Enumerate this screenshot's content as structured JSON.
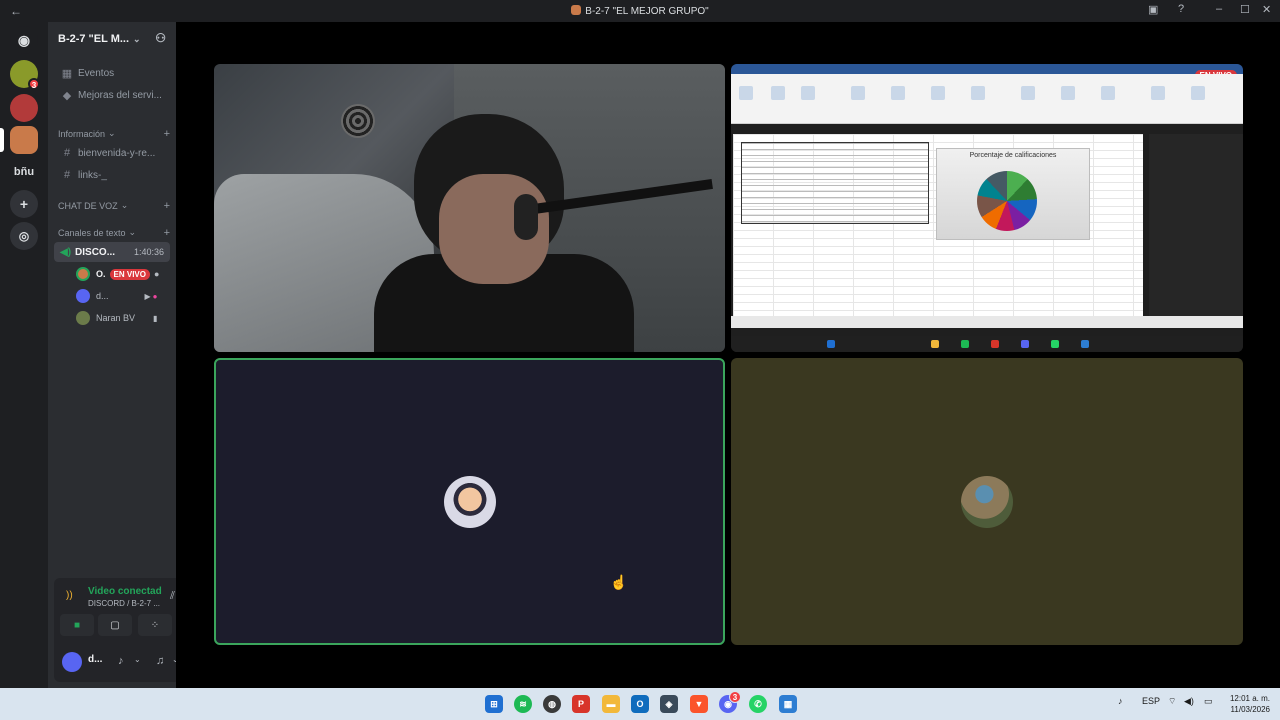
{
  "window": {
    "title": "B-2-7 \"EL MEJOR GRUPO\""
  },
  "rail": {
    "dm_icon": "discord-logo-icon",
    "servers": [
      {
        "name": "server-1",
        "color": "#8a9a2a",
        "badge": "3"
      },
      {
        "name": "server-2",
        "color": "#b23a3a"
      },
      {
        "name": "server-3",
        "color": "#c97a4a",
        "active": true
      },
      {
        "name": "server-4",
        "label": "bñu",
        "color": "#1e1f22"
      }
    ],
    "add_server_icon": "plus-icon",
    "discover_icon": "compass-icon"
  },
  "server": {
    "name": "B-2-7 \"EL M...",
    "top_items": [
      {
        "label": "Eventos",
        "icon": "calendar-icon"
      },
      {
        "label": "Mejoras del servi...",
        "icon": "boost-icon"
      }
    ],
    "categories": {
      "info": "Información",
      "voice": "CHAT DE VOZ",
      "text": "Canales de texto"
    },
    "text_channels": [
      {
        "label": "bienvenida-y-re..."
      },
      {
        "label": "links-_"
      }
    ],
    "voice_channel": {
      "label": "DISCO...",
      "timer": "1:40:36"
    },
    "voice_users": [
      {
        "name": "O.",
        "live": "EN VIVO",
        "color": "#c97a4a"
      },
      {
        "name": "d...",
        "color": "#5865f2"
      },
      {
        "name": "Naran BV",
        "color": "#6b7b4a"
      }
    ]
  },
  "voice_panel": {
    "status": "Video conectad",
    "channel": "DISCORD / B-2-7 ..."
  },
  "user": {
    "name": "d..."
  },
  "stage": {
    "live_badge": "EN VIVO",
    "spreadsheet": {
      "chart_title": "Porcentaje de calificaciones"
    }
  },
  "taskbar": {
    "apps": [
      {
        "name": "windows-start",
        "color": "#1f6fd1"
      },
      {
        "name": "spotify",
        "color": "#1db954"
      },
      {
        "name": "obs",
        "color": "#3a3a3a"
      },
      {
        "name": "pdf",
        "color": "#d8352a"
      },
      {
        "name": "files",
        "color": "#f2b83a"
      },
      {
        "name": "outlook",
        "color": "#0f6cbd"
      },
      {
        "name": "davinci",
        "color": "#3a4a5a"
      },
      {
        "name": "brave",
        "color": "#fb542b"
      },
      {
        "name": "discord",
        "color": "#5865f2",
        "badge": "3"
      },
      {
        "name": "whatsapp",
        "color": "#25d366"
      },
      {
        "name": "app-store",
        "color": "#2d7dd2"
      }
    ],
    "lang": "ESP",
    "time": "12:01 a. m.",
    "date": "11/03/2026"
  }
}
